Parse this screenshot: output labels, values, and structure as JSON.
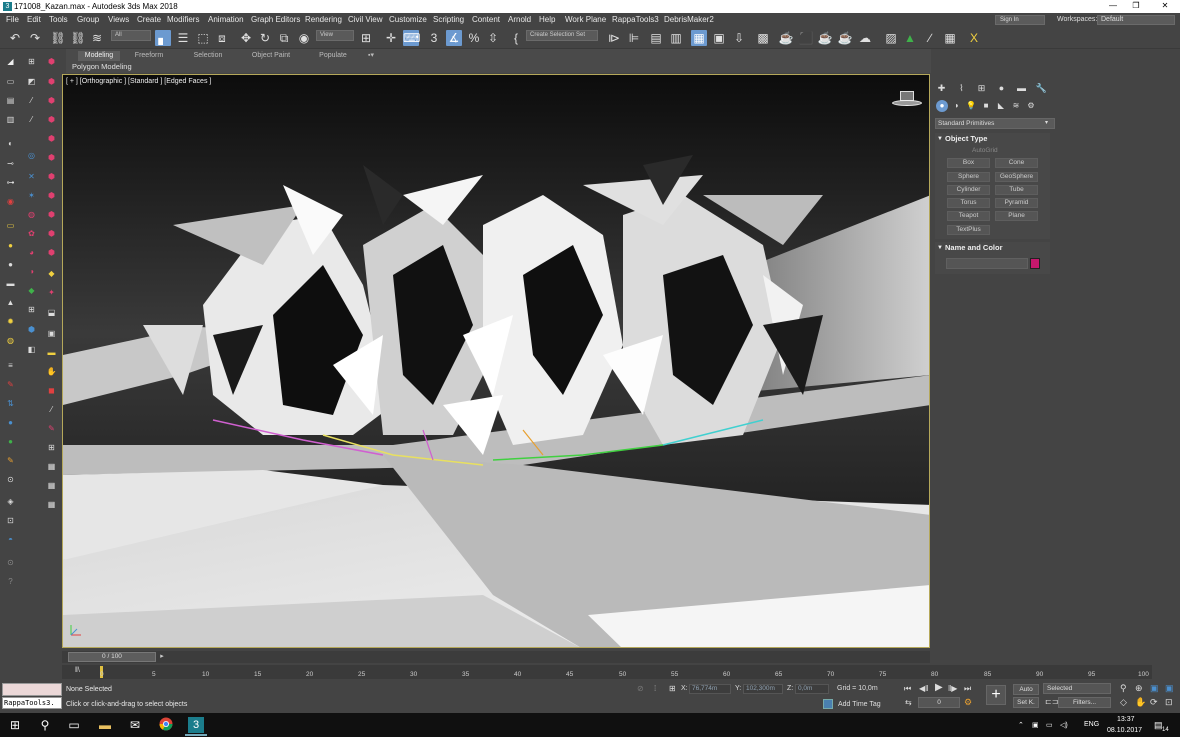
{
  "window": {
    "title": "171008_Kazan.max - Autodesk 3ds Max 2018",
    "icon": "3",
    "minimize": "—",
    "restore": "❐",
    "close": "✕"
  },
  "menubar": {
    "items": [
      "File",
      "Edit",
      "Tools",
      "Group",
      "Views",
      "Create",
      "Modifiers",
      "Animation",
      "Graph Editors",
      "Rendering",
      "Civil View",
      "Customize",
      "Scripting",
      "Content",
      "Arnold",
      "Help",
      "Work Plane",
      "RappaTools3",
      "DebrisMaker2"
    ],
    "signin": "Sign In",
    "workspaces_label": "Workspaces:",
    "workspace_value": "Default"
  },
  "toolbar": {
    "filter_value": "All",
    "refcoord_value": "View",
    "selection_set_placeholder": "Create Selection Set",
    "snap_label": "3",
    "icons": [
      "undo-icon",
      "redo-icon",
      "link-icon",
      "unlink-icon",
      "bind-spacewarp-icon",
      "select-object-icon",
      "select-by-name-icon",
      "rect-region-icon",
      "window-crossing-icon",
      "move-icon",
      "rotate-icon",
      "scale-icon",
      "place-icon",
      "pivot-icon",
      "manipulate-icon",
      "keyboard-shortcut-icon",
      "snap-icon",
      "angle-snap-icon",
      "percent-snap-icon",
      "spinner-snap-icon",
      "edit-named-selection-icon",
      "mirror-icon",
      "align-icon",
      "layer-explorer-icon",
      "scene-explorer-icon",
      "toggle-ribbon-icon",
      "curve-editor-icon",
      "schematic-view-icon",
      "material-editor-icon",
      "render-setup-icon",
      "render-frame-icon",
      "render-icon",
      "render-iterative-icon",
      "render-cloud-icon",
      "a360-icon",
      "arnold-icon",
      "xref-icon",
      "vray-icon",
      "snapshot-icon",
      "extra-icon"
    ]
  },
  "ribbon": {
    "tabs": [
      "Modeling",
      "Freeform",
      "Selection",
      "Object Paint",
      "Populate"
    ],
    "active_tab": "Modeling",
    "subtitle": "Polygon Modeling"
  },
  "viewport": {
    "label": "[ + ] [Orthographic ] [Standard ] [Edged Faces ]"
  },
  "command_panel": {
    "category": "Standard Primitives",
    "object_type_title": "Object Type",
    "autogrid": "AutoGrid",
    "buttons": [
      "Box",
      "Cone",
      "Sphere",
      "GeoSphere",
      "Cylinder",
      "Tube",
      "Torus",
      "Pyramid",
      "Teapot",
      "Plane",
      "TextPlus"
    ],
    "name_color_title": "Name and Color",
    "object_color": "#c5186d"
  },
  "timeline": {
    "slider_label": "0 / 100",
    "ruler_start": "0",
    "ticks": [
      "5",
      "10",
      "15",
      "20",
      "25",
      "30",
      "35",
      "40",
      "45",
      "50",
      "55",
      "60",
      "65",
      "70",
      "75",
      "80",
      "85",
      "90",
      "95",
      "100"
    ]
  },
  "status": {
    "maxscript": "RappaTools3.",
    "selection": "None Selected",
    "prompt": "Click or click-and-drag to select objects",
    "x_label": "X:",
    "x_value": "76,774m",
    "y_label": "Y:",
    "y_value": "102,300m",
    "z_label": "Z:",
    "z_value": "0,0m",
    "grid": "Grid = 10,0m",
    "add_time_tag": "Add Time Tag",
    "auto_key": "Auto",
    "set_key": "Set K.",
    "key_filter_value": "Selected",
    "filters": "Filters...",
    "frame_value": "0"
  },
  "taskbar": {
    "lang": "ENG",
    "time": "13:37",
    "date": "08.10.2017",
    "notifications": "14"
  }
}
